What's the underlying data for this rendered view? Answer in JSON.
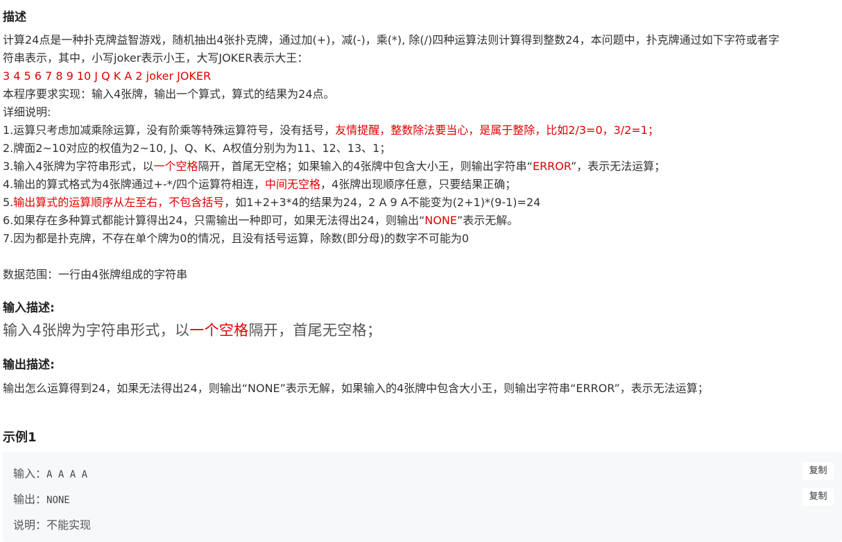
{
  "description": {
    "heading": "描述",
    "intro_1": "计算24点是一种扑克牌益智游戏，随机抽出4张扑克牌，通过加(+)，减(-)，乘(*), 除(/)四种运算法则计算得到整数24，本问题中，扑克牌通过如下字符或者字",
    "intro_2": "符串表示，其中，小写joker表示小王，大写JOKER表示大王：",
    "cards": "3 4 5 6 7 8 9 10 J Q K A 2 joker JOKER",
    "requirement": "本程序要求实现：输入4张牌，输出一个算式，算式的结果为24点。",
    "detail_label": "详细说明:",
    "rule1_a": "1.运算只考虑加减乘除运算，没有阶乘等特殊运算符号，没有括号，",
    "rule1_b": "友情提醒，整数除法要当心，是属于整除，比如2/3=0，3/2=1；",
    "rule2": "2.牌面2~10对应的权值为2~10, J、Q、K、A权值分别为为11、12、13、1；",
    "rule3_a": "3.输入4张牌为字符串形式，以",
    "rule3_b": "一个空格",
    "rule3_c": "隔开，首尾无空格；如果输入的4张牌中包含大小王，则输出字符串“",
    "rule3_d": "ERROR",
    "rule3_e": "”，表示无法运算；",
    "rule4_a": "4.输出的算式格式为4张牌通过+-*/四个运算符相连，",
    "rule4_b": "中间无空格",
    "rule4_c": "，4张牌出现顺序任意，只要结果正确；",
    "rule5_a": "5.",
    "rule5_b": "输出算式的运算顺序从左至右，不包含括号",
    "rule5_c": "，如1+2+3*4的结果为24，2 A 9 A不能变为(2+1)*(9-1)=24",
    "rule6_a": "6.如果存在多种算式都能计算得出24，只需输出一种即可，如果无法得出24，则输出“",
    "rule6_b": "NONE",
    "rule6_c": "”表示无解。",
    "rule7": "7.因为都是扑克牌，不存在单个牌为0的情况，且没有括号运算，除数(即分母)的数字不可能为0",
    "range": "数据范围：一行由4张牌组成的字符串"
  },
  "input_section": {
    "heading": "输入描述:",
    "text_a": "输入4张牌为字符串形式，以",
    "text_b": "一个空格",
    "text_c": "隔开，首尾无空格；"
  },
  "output_section": {
    "heading": "输出描述:",
    "text": "输出怎么运算得到24，如果无法得出24，则输出“NONE”表示无解，如果输入的4张牌中包含大小王，则输出字符串“ERROR”，表示无法运算；"
  },
  "example": {
    "heading": "示例1",
    "input_label": "输入：",
    "input_value": "A A A A",
    "output_label": "输出：",
    "output_value": "NONE",
    "note_label": "说明：",
    "note_value": "不能实现",
    "copy_label": "复制"
  },
  "colors": {
    "highlight": "#e00000",
    "example_bg": "#f7f8fa"
  }
}
